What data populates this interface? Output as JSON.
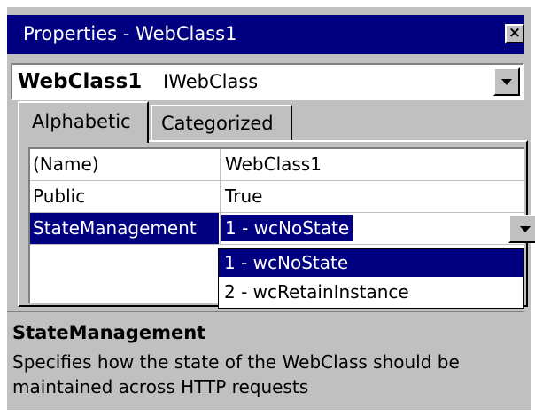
{
  "window": {
    "title": "Properties - WebClass1",
    "close_label": "×"
  },
  "object_selector": {
    "name": "WebClass1",
    "type": "IWebClass"
  },
  "tabs": [
    {
      "label": "Alphabetic",
      "active": true
    },
    {
      "label": "Categorized",
      "active": false
    }
  ],
  "properties": [
    {
      "name": "(Name)",
      "value": "WebClass1"
    },
    {
      "name": "Public",
      "value": "True"
    },
    {
      "name": "StateManagement",
      "value": "1 - wcNoState",
      "selected": true
    }
  ],
  "dropdown_options": [
    {
      "label": "1 - wcNoState",
      "selected": true
    },
    {
      "label": "2 - wcRetainInstance",
      "selected": false
    }
  ],
  "description": {
    "title": "StateManagement",
    "text": "Specifies how the state of the WebClass should be maintained across HTTP requests"
  },
  "colors": {
    "titlebar": "#000080",
    "selection": "#000080",
    "face": "#c0c0c0"
  }
}
